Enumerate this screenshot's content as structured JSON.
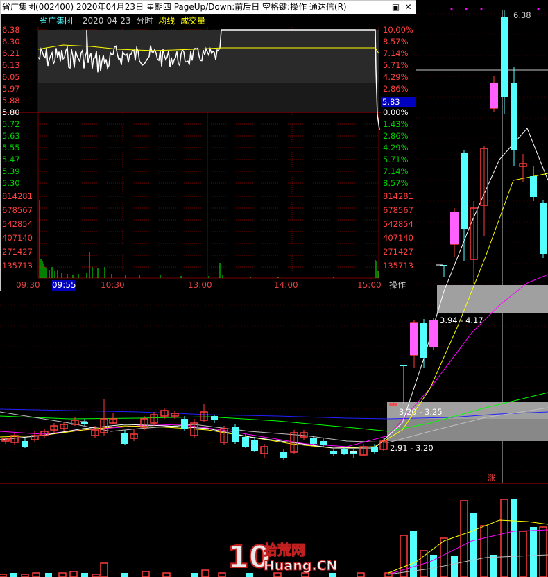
{
  "colors": {
    "up": "#ff3c3c",
    "down": "#54ffff",
    "grid": "#7a0000",
    "price_line": "#ffffff",
    "avg_line": "#ffff00",
    "volume_label": "#00ff00",
    "ma_yellow": "#ffff00",
    "ma_magenta": "#ff00ff",
    "ma_green": "#00ff00",
    "ma_blue": "#2020ff",
    "ma_gray": "#c0c0c0",
    "zone": "#a0a0a0",
    "current_price_bg": "#0000c0"
  },
  "kline": {
    "high_label": "6.38",
    "zones": [
      {
        "label": "3.94 - 4.17"
      },
      {
        "label": "3.20 - 3.25"
      },
      {
        "label": "2.91 - 3.20"
      }
    ],
    "zhang_label": "涨"
  },
  "popup": {
    "title": "省广集团(002400)  2020年04月23日  星期四  PageUp/Down:前后日  空格键:操作  通达信(R)",
    "buttons": {
      "minimize": "▣",
      "close": "✕"
    },
    "stock_name": "省广集团",
    "date": "2020-04-23",
    "mode": "分时",
    "avg_label": "均线",
    "volume_label": "成交量",
    "left_prices": [
      "6.38",
      "6.30",
      "6.21",
      "6.13",
      "6.05",
      "5.97",
      "5.88",
      "5.80",
      "5.72",
      "5.63",
      "5.55",
      "5.47",
      "5.39",
      "5.30"
    ],
    "right_pcts": [
      "10.00%",
      "8.57%",
      "7.14%",
      "5.71%",
      "4.29%",
      "2.86%",
      "1.43%",
      "0.00%",
      "1.43%",
      "2.86%",
      "4.29%",
      "5.71%",
      "7.14%",
      "8.57%"
    ],
    "current_price": "5.83",
    "volume_ticks": [
      "814281",
      "678567",
      "542854",
      "407140",
      "271427",
      "135713"
    ],
    "time_labels": [
      "09:30",
      "09:55",
      "10:30",
      "13:00",
      "14:00",
      "15:00"
    ],
    "action_label": "操作"
  },
  "watermark": {
    "brand": "拾荒网",
    "domain": "Huang.CN",
    "digits": "10"
  }
}
